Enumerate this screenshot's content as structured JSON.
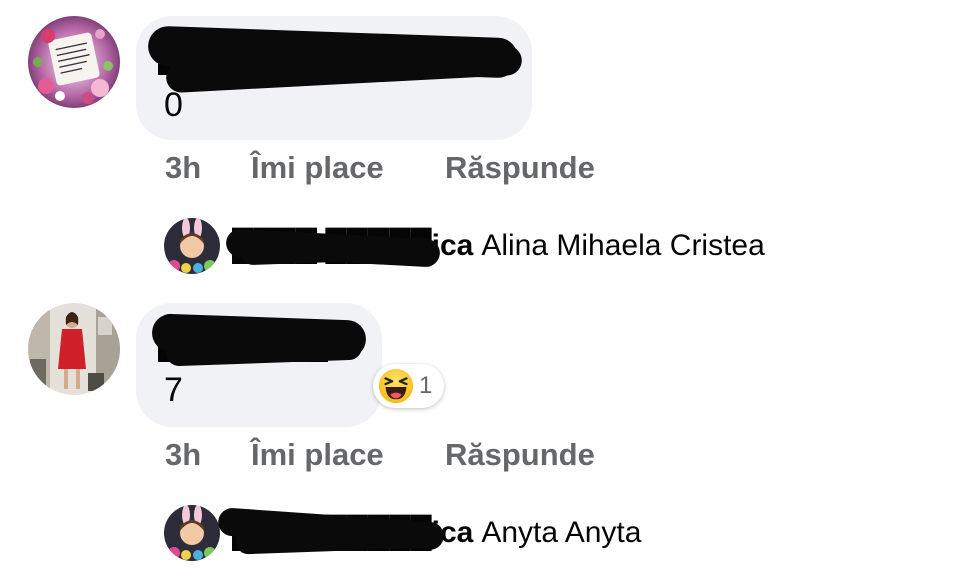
{
  "comments": [
    {
      "author": "██████ ██████",
      "text": "0",
      "time": "3h",
      "like_label": "Îmi place",
      "reply_label": "Răspunde",
      "reply_preview": {
        "author": "████ █████ica",
        "text": "Alina Mihaela Cristea"
      }
    },
    {
      "author": "████████",
      "text": "7",
      "time": "3h",
      "like_label": "Îmi place",
      "reply_label": "Răspunde",
      "reaction": {
        "icon": "haha-emoji-icon",
        "count": "1"
      },
      "reply_preview": {
        "author": "████ █████ica",
        "text": "Anyta Anyta"
      }
    }
  ],
  "colors": {
    "bubble": "#f0f2f5",
    "meta_text": "#65676b",
    "text": "#050505",
    "redaction": "#0a0a0a"
  }
}
